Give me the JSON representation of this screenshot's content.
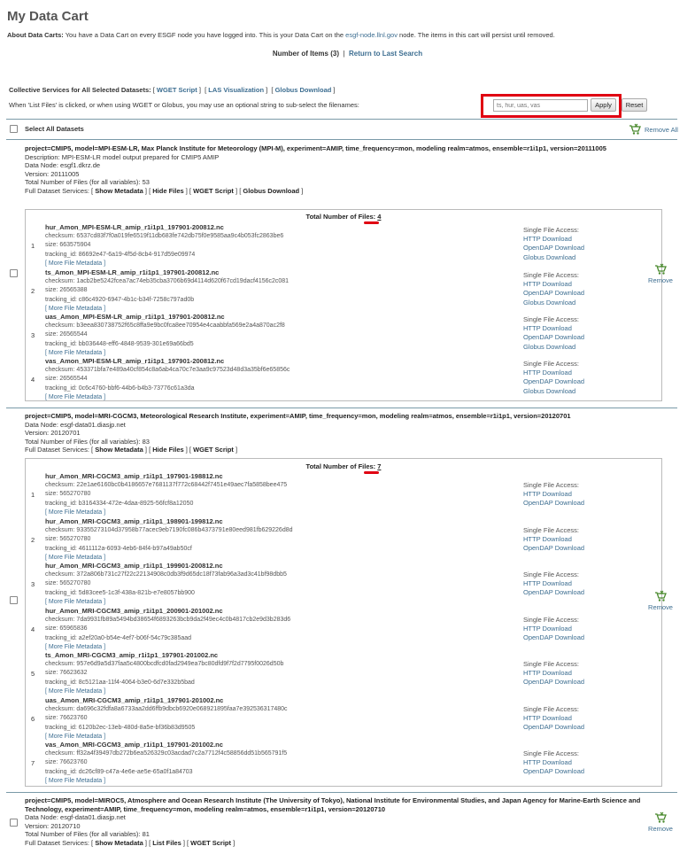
{
  "page": {
    "title": "My Data Cart",
    "about_label": "About Data Carts:",
    "about_text_before": " You have a Data Cart on every ESGF node you have logged into. This is your Data Cart on the ",
    "about_node_link": "esgf-node.llnl.gov",
    "about_text_after": " node. The items in this cart will persist until removed.",
    "items_label": "Number of Items (3)",
    "separator": "|",
    "last_search": "Return to Last Search"
  },
  "collective": {
    "label": "Collective Services for All Selected Datasets:",
    "wget": "WGET Script",
    "las": "LAS Visualization",
    "globus": "Globus Download",
    "hint": "When 'List Files' is clicked, or when using WGET or Globus, you may use an optional string to sub-select the filenames:",
    "filter_value": "ts, hur, uas, vas",
    "apply": "Apply",
    "reset": "Reset"
  },
  "select_all": "Select All Datasets",
  "remove_all": "Remove All",
  "colors": {
    "link": "#3d6e91",
    "highlight": "#e00012",
    "rule": "#7a9aa8"
  },
  "icons": {
    "remove": "cart-remove-icon"
  },
  "labels": {
    "description": "Description:",
    "data_node": "Data Node:",
    "version": "Version:",
    "total_files": "Total Number of Files (for all variables):",
    "full_services": "Full Dataset Services:",
    "show_metadata": "Show Metadata",
    "hide_files": "Hide Files",
    "list_files": "List Files",
    "wget": "WGET Script",
    "globus": "Globus Download",
    "total_files_box": "Total Number of Files:",
    "single_access": "Single File Access:",
    "http": "HTTP Download",
    "opendap": "OpenDAP Download",
    "globus_dl": "Globus Download",
    "more_meta": "[ More File Metadata ]",
    "checksum": "checksum:",
    "size": "size:",
    "tracking": "tracking_id:",
    "remove": "Remove"
  },
  "datasets": [
    {
      "title": "project=CMIP5, model=MPI-ESM-LR, Max Planck Institute for Meteorology (MPI-M), experiment=AMIP, time_frequency=mon, modeling realm=atmos, ensemble=r1i1p1, version=20111005",
      "description": "MPI-ESM-LR model output prepared for CMIP5 AMIP",
      "data_node": "esgf1.dkrz.de",
      "version": "20111005",
      "total_files": "53",
      "box_total": "4",
      "files": [
        {
          "n": "1",
          "name": "hur_Amon_MPI-ESM-LR_amip_r1i1p1_197901-200812.nc",
          "checksum": "6537cd83f7f0a019fe6519f11db683fe742db75f0e9585aa9c4b053fc2863be6",
          "size": "663575904",
          "tracking": "86692e47-6a19-4f5d-8cb4-917d59e09974"
        },
        {
          "n": "2",
          "name": "ts_Amon_MPI-ESM-LR_amip_r1i1p1_197901-200812.nc",
          "checksum": "1acb2be5242fcea7ac74eb35cba3706b69d4114d620f67cd19dacf4156c2c081",
          "size": "26565388",
          "tracking": "c86c4920-6947-4b1c-b34f-7258c797ad0b"
        },
        {
          "n": "3",
          "name": "uas_Amon_MPI-ESM-LR_amip_r1i1p1_197901-200812.nc",
          "checksum": "b3eea830738752f65c8ffa9e9bc0fca8ee70954e4caabbfa569e2a4a870ac2f8",
          "size": "26565544",
          "tracking": "bb036448-eff6-4848-9539-301e69a66bd5"
        },
        {
          "n": "4",
          "name": "vas_Amon_MPI-ESM-LR_amip_r1i1p1_197901-200812.nc",
          "checksum": "453371bfa7e489a40cf854c8a6ab4ca70c7e3aa9c97523d48d3a35bf6e65856c",
          "size": "26565544",
          "tracking": "0c6c4760-bbf6-44b6-b4b3-73776c61a3da"
        }
      ]
    },
    {
      "title": "project=CMIP5, model=MRI-CGCM3, Meteorological Research Institute, experiment=AMIP, time_frequency=mon, modeling realm=atmos, ensemble=r1i1p1, version=20120701",
      "data_node": "esgf-data01.diasjp.net",
      "version": "20120701",
      "total_files": "83",
      "box_total": "7",
      "files": [
        {
          "n": "1",
          "name": "hur_Amon_MRI-CGCM3_amip_r1i1p1_197901-198812.nc",
          "checksum": "22e1ae6160bc0b4186657e7681137f772c68442f7451e49aec7fa5858bee475",
          "size": "565270780",
          "tracking": "b3164334-472e-4daa-8925-56fcf8a12050"
        },
        {
          "n": "2",
          "name": "hur_Amon_MRI-CGCM3_amip_r1i1p1_198901-199812.nc",
          "checksum": "93355273104d37958b77acec9eb7190fc086b4373791e80eed981fb629226d8d",
          "size": "565270780",
          "tracking": "4611112a-6093-4eb6-84f4-b97a49ab50cf"
        },
        {
          "n": "3",
          "name": "hur_Amon_MRI-CGCM3_amip_r1i1p1_199901-200812.nc",
          "checksum": "372a806b731c27f22c22134908c0db3f9d65dc18f73fab96a3ad3c41bf98dbb5",
          "size": "565270780",
          "tracking": "5d83cee5-1c3f-438a-821b-e7e8057bb900"
        },
        {
          "n": "4",
          "name": "hur_Amon_MRI-CGCM3_amip_r1i1p1_200901-201002.nc",
          "checksum": "7da9931fb89a5494bd38654f6893263bcb9da2f49ec4c0b4817cb2e9d3b283d6",
          "size": "65965836",
          "tracking": "a2ef20a0-b54e-4ef7-b06f-54c79c385aad"
        },
        {
          "n": "5",
          "name": "ts_Amon_MRI-CGCM3_amip_r1i1p1_197901-201002.nc",
          "checksum": "957e6d9a5d37faa5c4800bcdfcd0fad2949ea7bc80dfd9f7f2d7795f0026d50b",
          "size": "76623632",
          "tracking": "8c5121aa-11f4-4064-b3e0-6d7e332b5bad"
        },
        {
          "n": "6",
          "name": "uas_Amon_MRI-CGCM3_amip_r1i1p1_197901-201002.nc",
          "checksum": "da696c32fdfa8a6733aa2dd6ffb9dbcb6920e068921895faa7e392536317480c",
          "size": "76623760",
          "tracking": "6120b2ec-13eb-480d-8a5e-bf36b83d9505"
        },
        {
          "n": "7",
          "name": "vas_Amon_MRI-CGCM3_amip_r1i1p1_197901-201002.nc",
          "checksum": "ff32a4f39497db272b6ea526329c03acdad7c2a7712f4c58856dd51b565791f5",
          "size": "76623760",
          "tracking": "dc26cf89-c47a-4e6e-ae5e-65a0f1a84703"
        }
      ]
    },
    {
      "title": "project=CMIP5, model=MIROC5, Atmosphere and Ocean Research Institute (The University of Tokyo), National Institute for Environmental Studies, and Japan Agency for Marine-Earth Science and Technology, experiment=AMIP, time_frequency=mon, modeling realm=atmos, ensemble=r1i1p1, version=20120710",
      "data_node": "esgf-data01.diasjp.net",
      "version": "20120710",
      "total_files": "81"
    }
  ]
}
